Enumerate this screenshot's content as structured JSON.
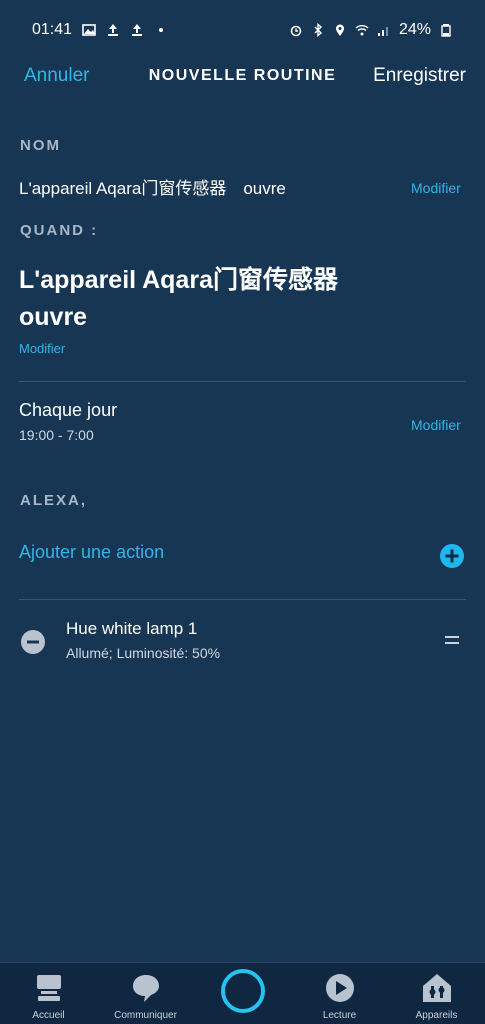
{
  "status": {
    "time": "01:41",
    "battery": "24%",
    "left_icons": [
      "image-icon",
      "upload-icon",
      "upload-icon",
      "dot-icon"
    ],
    "right_icons": [
      "alarm-icon",
      "bluetooth-icon",
      "location-icon",
      "wifi-icon",
      "signal-icon",
      "battery-icon"
    ]
  },
  "header": {
    "cancel": "Annuler",
    "title": "NOUVELLE ROUTINE",
    "save": "Enregistrer"
  },
  "name_section": {
    "label": "NOM",
    "value": "L'appareil Aqara门窗传感器　ouvre",
    "edit": "Modifier"
  },
  "when_section": {
    "label": "QUAND :",
    "title_line1": "L'appareil Aqara门窗传感器",
    "title_line2": "ouvre",
    "edit": "Modifier"
  },
  "schedule": {
    "title": "Chaque jour",
    "time": "19:00 - 7:00",
    "edit": "Modifier"
  },
  "alexa_section": {
    "label": "ALEXA,",
    "add_action": "Ajouter une action"
  },
  "actions": [
    {
      "title": "Hue white lamp 1",
      "subtitle": "Allumé; Luminosité: 50%"
    }
  ],
  "bottom_nav": {
    "home": "Accueil",
    "communicate": "Communiquer",
    "play": "Lecture",
    "devices": "Appareils"
  },
  "colors": {
    "background": "#173654",
    "accent": "#33b5e8",
    "nav_background": "#0f2740"
  }
}
